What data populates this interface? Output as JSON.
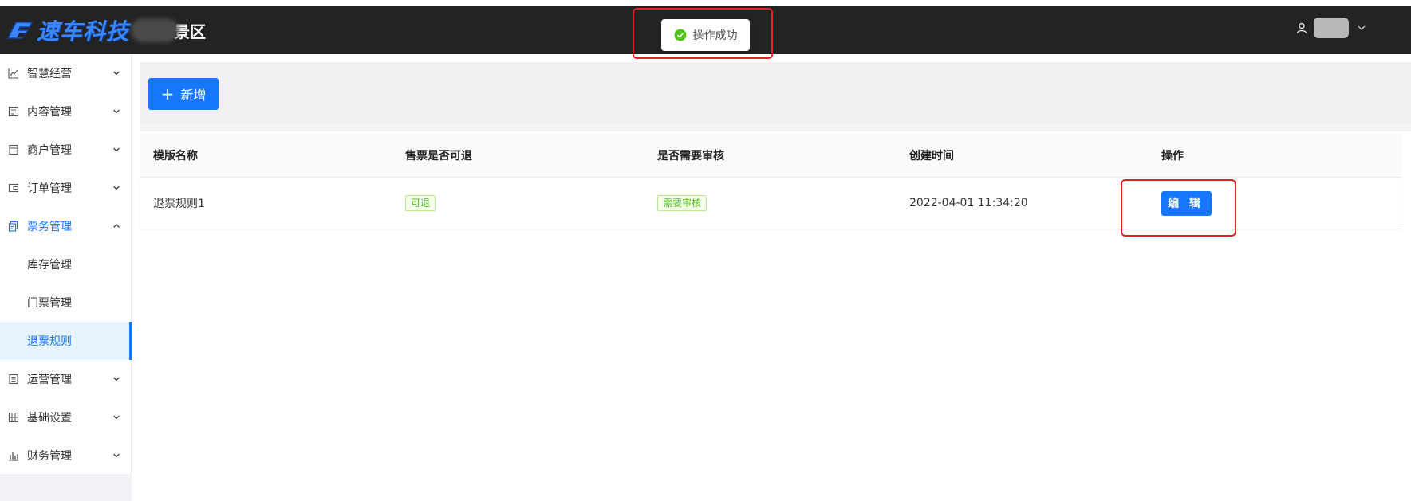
{
  "header": {
    "logo_text": "速车科技",
    "scenic_suffix": "景区",
    "icons": [
      "logo-icon",
      "user-icon",
      "chevron-down-icon"
    ]
  },
  "toast": {
    "message": "操作成功",
    "icon": "check-circle-icon",
    "color": "#52c41a"
  },
  "sidebar": {
    "items": [
      {
        "label": "智慧经营",
        "icon": "line-chart-icon",
        "expanded": false
      },
      {
        "label": "内容管理",
        "icon": "document-icon",
        "expanded": false
      },
      {
        "label": "商户管理",
        "icon": "shop-icon",
        "expanded": false
      },
      {
        "label": "订单管理",
        "icon": "wallet-icon",
        "expanded": false
      },
      {
        "label": "票务管理",
        "icon": "ticket-icon",
        "expanded": true,
        "active": true,
        "children": [
          {
            "label": "库存管理"
          },
          {
            "label": "门票管理"
          },
          {
            "label": "退票规则",
            "selected": true
          }
        ]
      },
      {
        "label": "运营管理",
        "icon": "clipboard-icon",
        "expanded": false
      },
      {
        "label": "基础设置",
        "icon": "settings-grid-icon",
        "expanded": false
      },
      {
        "label": "财务管理",
        "icon": "bar-chart-icon",
        "expanded": false
      }
    ]
  },
  "toolbar": {
    "add_label": "新增",
    "add_icon": "plus-icon"
  },
  "table": {
    "columns": [
      "模版名称",
      "售票是否可退",
      "是否需要审核",
      "创建时间",
      "操作"
    ],
    "rows": [
      {
        "name": "退票规则1",
        "refundable": "可退",
        "review": "需要审核",
        "created": "2022-04-01 11:34:20",
        "action": "编 辑"
      }
    ]
  },
  "colors": {
    "primary": "#1677ff",
    "header_bg": "#232323",
    "success": "#52c41a",
    "highlight": "#e02424"
  }
}
